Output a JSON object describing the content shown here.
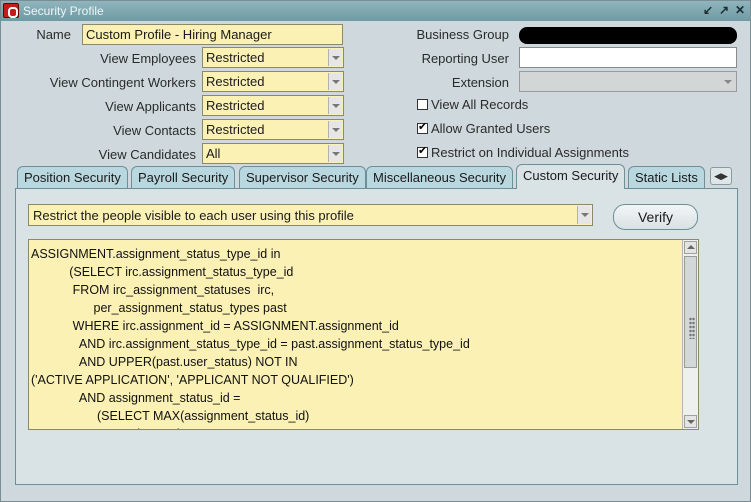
{
  "window": {
    "title": "Security Profile"
  },
  "form": {
    "name_label": "Name",
    "name_value": "Custom Profile - Hiring Manager",
    "view_employees_label": "View Employees",
    "view_employees_value": "Restricted",
    "view_contingent_label": "View Contingent Workers",
    "view_contingent_value": "Restricted",
    "view_applicants_label": "View Applicants",
    "view_applicants_value": "Restricted",
    "view_contacts_label": "View Contacts",
    "view_contacts_value": "Restricted",
    "view_candidates_label": "View Candidates",
    "view_candidates_value": "All",
    "business_group_label": "Business Group",
    "reporting_user_label": "Reporting User",
    "reporting_user_value": "",
    "extension_label": "Extension",
    "extension_value": "",
    "view_all_records_label": "View All Records",
    "view_all_records_checked": false,
    "allow_granted_users_label": "Allow Granted Users",
    "allow_granted_users_checked": true,
    "restrict_individual_label": "Restrict on Individual Assignments",
    "restrict_individual_checked": true
  },
  "tabs": [
    {
      "label": "Position Security",
      "active": false
    },
    {
      "label": "Payroll Security",
      "active": false
    },
    {
      "label": "Supervisor Security",
      "active": false
    },
    {
      "label": "Miscellaneous Security",
      "active": false
    },
    {
      "label": "Custom Security",
      "active": true
    },
    {
      "label": "Static Lists",
      "active": false
    }
  ],
  "custom_security": {
    "restriction_value": "Restrict the people visible to each user using this profile",
    "verify_label": "Verify",
    "sql_text": "ASSIGNMENT.assignment_status_type_id in\n           (SELECT irc.assignment_status_type_id\n            FROM irc_assignment_statuses  irc,\n                  per_assignment_status_types past\n            WHERE irc.assignment_id = ASSIGNMENT.assignment_id\n              AND irc.assignment_status_type_id = past.assignment_status_type_id\n              AND UPPER(past.user_status) NOT IN\n('ACTIVE APPLICATION', 'APPLICANT NOT QUALIFIED')\n              AND assignment_status_id =\n                   (SELECT MAX(assignment_status_id)\n                   FROM irc_assi"
  }
}
